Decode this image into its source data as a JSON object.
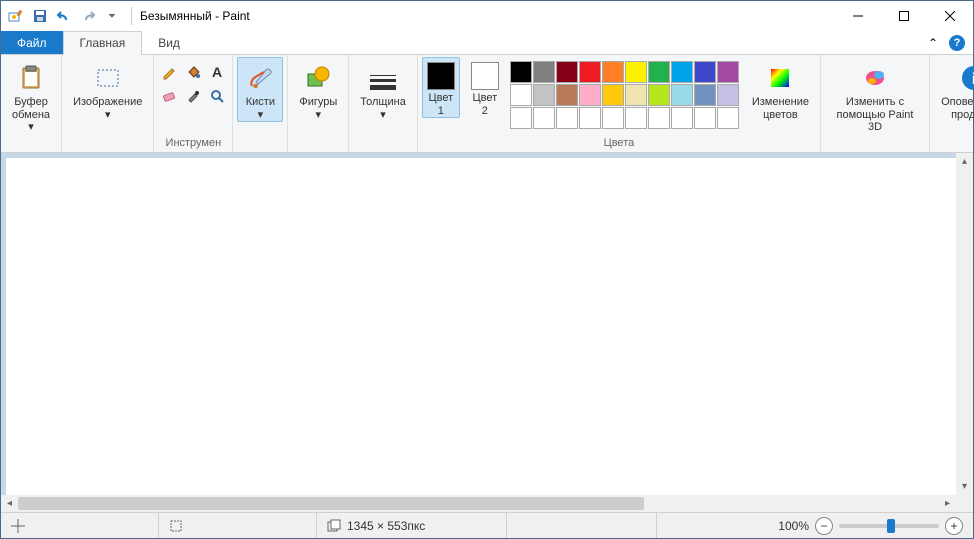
{
  "title": "Безымянный - Paint",
  "tabs": {
    "file": "Файл",
    "home": "Главная",
    "view": "Вид"
  },
  "groups": {
    "clipboard": {
      "btn": "Буфер\nобмена ▾"
    },
    "image": {
      "btn": "Изображение\n▾"
    },
    "tools": {
      "label": "Инструмен"
    },
    "brushes": {
      "btn": "Кисти\n▾"
    },
    "shapes": {
      "btn": "Фигуры\n▾"
    },
    "thickness": {
      "btn": "Толщина\n▾"
    },
    "color1": {
      "label": "Цвет\n1"
    },
    "color2": {
      "label": "Цвет\n2"
    },
    "editcolors": {
      "label": "Изменение\nцветов"
    },
    "colors_label": "Цвета",
    "paint3d": {
      "label": "Изменить с\nпомощью Paint 3D"
    },
    "alert": {
      "label": "Оповещение\nпродукта"
    }
  },
  "palette_row1": [
    "#000000",
    "#7f7f7f",
    "#880015",
    "#ed1c24",
    "#ff7f27",
    "#fff200",
    "#22b14c",
    "#00a2e8",
    "#3f48cc",
    "#a349a4"
  ],
  "palette_row2": [
    "#ffffff",
    "#c3c3c3",
    "#b97a57",
    "#ffaec9",
    "#ffc90e",
    "#efe4b0",
    "#b5e61d",
    "#99d9ea",
    "#7092be",
    "#c8bfe7"
  ],
  "color1_value": "#000000",
  "color2_value": "#ffffff",
  "status": {
    "dimensions": "1345 × 553пкс",
    "zoom": "100%"
  }
}
